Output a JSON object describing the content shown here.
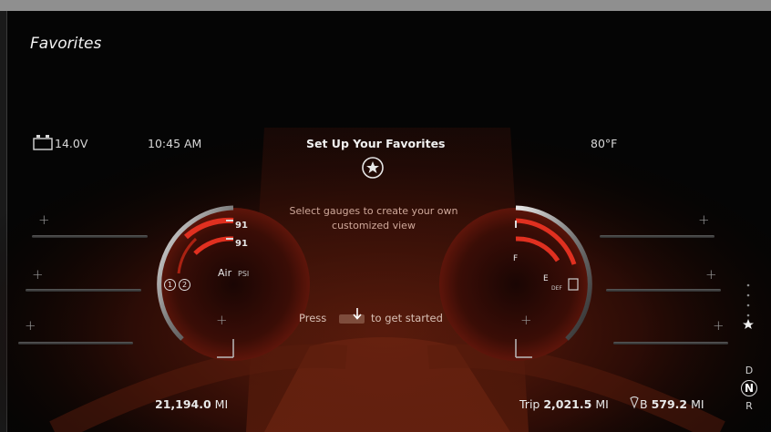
{
  "header": {
    "title": "Favorites"
  },
  "status": {
    "battery": "14.0V",
    "time": "10:45 AM",
    "outside_temp": "80°F"
  },
  "setup_card": {
    "title": "Set Up Your Favorites",
    "description": "Select gauges to create your own customized view",
    "press_label": "Press",
    "press_suffix": "to get started",
    "icon": "star-circle-icon",
    "button_icon": "download-arrow-icon"
  },
  "left_gauge": {
    "value_1": "91",
    "value_2": "91",
    "label": "Air",
    "unit": "PSI",
    "circuit_1": "1",
    "circuit_2": "2"
  },
  "right_gauge": {
    "full_label": "F",
    "empty_label": "E",
    "def_label": "DEF"
  },
  "odometer": {
    "value": "21,194.0",
    "unit": "MI"
  },
  "trip": {
    "label": "Trip",
    "value": "2,021.5",
    "unit": "MI"
  },
  "range": {
    "prefix": "B",
    "value": "579.2",
    "unit": "MI"
  },
  "gear": {
    "upper": "D",
    "current": "N",
    "lower": "R"
  },
  "page_indicator": {
    "pages": 4,
    "active_icon": "star-icon"
  },
  "colors": {
    "accent": "#d02a18",
    "background": "#050505",
    "glow": "#6a1808"
  }
}
